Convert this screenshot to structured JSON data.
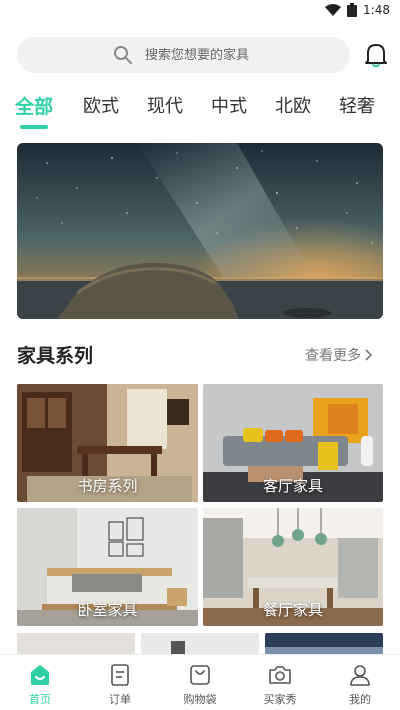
{
  "status_bar": {
    "time": "1:48"
  },
  "search": {
    "placeholder": "搜索您想要的家具"
  },
  "tabs": [
    {
      "label": "全部"
    },
    {
      "label": "欧式"
    },
    {
      "label": "现代"
    },
    {
      "label": "中式"
    },
    {
      "label": "北欧"
    },
    {
      "label": "轻奢"
    }
  ],
  "active_tab": "全部",
  "section": {
    "title": "家具系列",
    "more_label": "查看更多"
  },
  "categories": [
    {
      "label": "书房系列"
    },
    {
      "label": "客厅家具"
    },
    {
      "label": "卧室家具"
    },
    {
      "label": "餐厅家具"
    }
  ],
  "bottom_nav": [
    {
      "label": "首页",
      "icon": "home-icon"
    },
    {
      "label": "订单",
      "icon": "order-icon"
    },
    {
      "label": "购物袋",
      "icon": "bag-icon"
    },
    {
      "label": "买家秀",
      "icon": "camera-icon"
    },
    {
      "label": "我的",
      "icon": "profile-icon"
    }
  ],
  "colors": {
    "accent": "#2fd0a6",
    "search_bg": "#f1f1f1"
  }
}
